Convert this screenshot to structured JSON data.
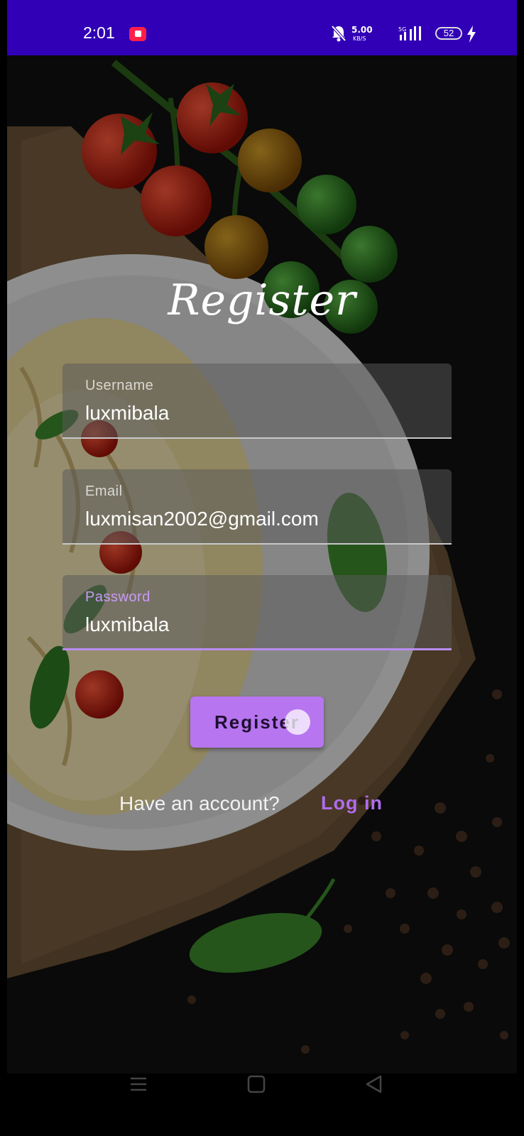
{
  "status_bar": {
    "time": "2:01",
    "net_speed_top": "5.00",
    "net_speed_bottom": "KB/S",
    "network_type": "5G",
    "battery_level": "52",
    "icons": [
      "youtube-notification-icon",
      "bell-off-icon",
      "signal-icon",
      "battery-icon",
      "charging-icon"
    ],
    "background_color": "#3100b6"
  },
  "form": {
    "title": "Register",
    "fields": [
      {
        "label": "Username",
        "value": "luxmibala"
      },
      {
        "label": "Email",
        "value": "luxmisan2002@gmail.com"
      },
      {
        "label": "Password",
        "value": "luxmibala"
      }
    ],
    "submit_label": "Register",
    "account_prompt": "Have an account?",
    "login_label": "Log in"
  },
  "nav_bar": {
    "icons": [
      "menu-icon",
      "home-icon",
      "back-icon"
    ]
  },
  "colors": {
    "accent": "#b775f0",
    "link": "#b06cec",
    "focused_underline": "#b98cf2"
  }
}
